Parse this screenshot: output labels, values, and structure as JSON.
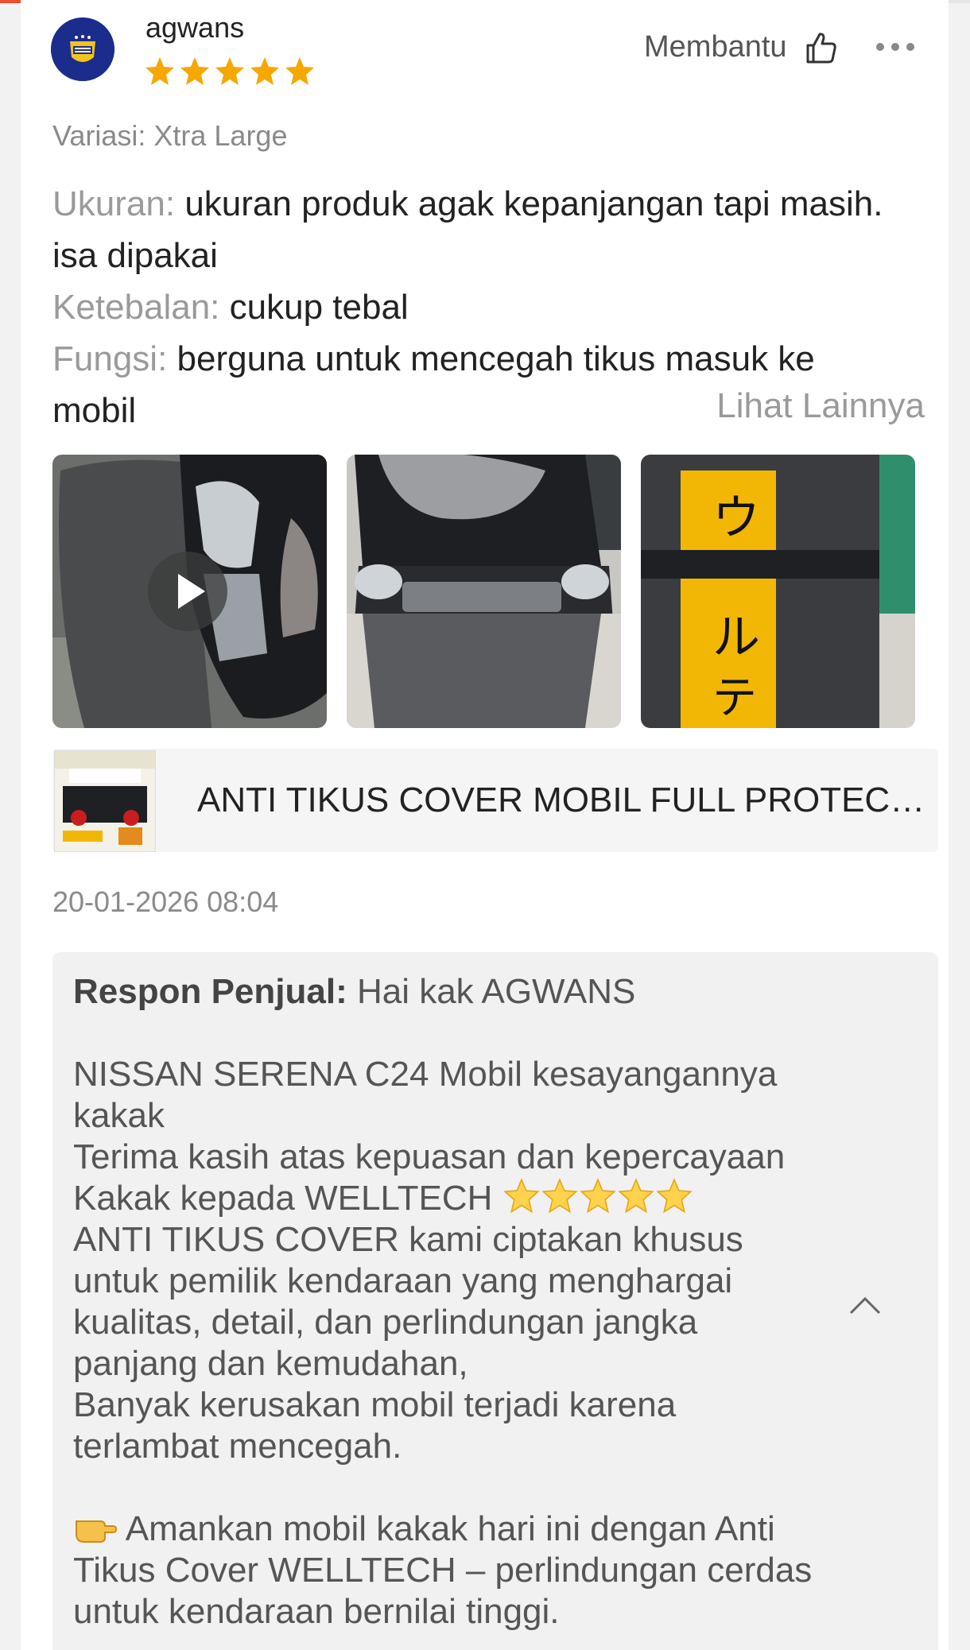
{
  "page_progress": 0.5,
  "review": {
    "username": "agwans",
    "rating": 5,
    "helpful_label": "Membantu",
    "variation": "Variasi: Xtra Large",
    "attributes": [
      {
        "label": "Ukuran:",
        "value": "ukuran produk agak kepanjangan tapi masih. isa dipakai"
      },
      {
        "label": "Ketebalan:",
        "value": "cukup tebal"
      },
      {
        "label": "Fungsi:",
        "value": "berguna untuk mencegah tikus masuk ke mobil"
      }
    ],
    "see_more": "Lihat Lainnya",
    "media": [
      {
        "type": "video",
        "label": "front of black car with grey cover"
      },
      {
        "type": "image",
        "label": "car front covered with grey cover"
      },
      {
        "type": "image",
        "label": "rolled cover with yellow label"
      }
    ],
    "product_name": "ANTI TIKUS COVER MOBIL FULL PROTECTION",
    "date": "20-01-2026 08:04"
  },
  "seller_response": {
    "label": "Respon Penjual:",
    "greeting": "Hai kak AGWANS",
    "lines": [
      "NISSAN SERENA C24 Mobil kesayangannya kakak",
      "Terima kasih atas kepuasan dan kepercayaan Kakak kepada WELLTECH",
      "ANTI TIKUS COVER kami ciptakan khusus untuk pemilik kendaraan yang menghargai kualitas, detail, dan perlindungan jangka panjang dan kemudahan,",
      "Banyak kerusakan mobil terjadi karena terlambat mencegah."
    ],
    "closing": "Amankan mobil kakak hari ini dengan Anti Tikus Cover WELLTECH – perlindungan cerdas untuk kendaraan bernilai tinggi."
  },
  "icons": {
    "helpful": "thumbs-up-icon",
    "more": "more-dots-icon",
    "play": "play-icon",
    "collapse": "chevron-up-icon"
  },
  "colors": {
    "accent": "#ee4d2d",
    "star": "#f6a700"
  }
}
